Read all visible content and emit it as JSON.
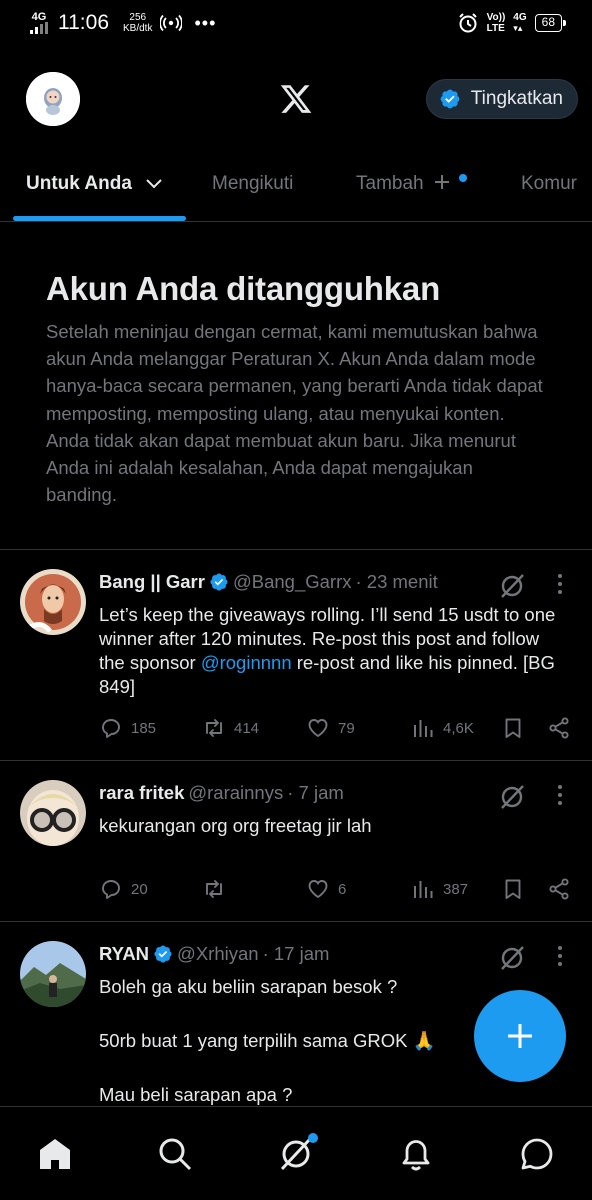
{
  "status_bar": {
    "network_left": "4G",
    "time": "11:06",
    "speed_value": "256",
    "speed_unit": "KB/dtk",
    "vo": "Vo))",
    "lte": "LTE",
    "network_right": "4G",
    "battery": "68"
  },
  "header": {
    "upgrade_label": "Tingkatkan"
  },
  "tabs": [
    {
      "label": "Untuk Anda",
      "active": true
    },
    {
      "label": "Mengikuti",
      "active": false
    },
    {
      "label": "Tambah",
      "active": false
    },
    {
      "label": "Komur",
      "active": false
    }
  ],
  "suspension": {
    "title": "Akun Anda ditangguhkan",
    "body": "Setelah meninjau dengan cermat, kami memutuskan bahwa akun Anda melanggar Peraturan X. Akun Anda dalam mode hanya-baca secara permanen, yang berarti Anda tidak dapat memposting, memposting ulang, atau menyukai konten. Anda tidak akan dapat membuat akun baru. Jika menurut Anda ini adalah kesalahan, Anda dapat mengajukan banding."
  },
  "posts": [
    {
      "name": "Bang || Garr",
      "verified": true,
      "handle": "@Bang_Garrx",
      "time": "· 23 menit",
      "text_before": "Let’s keep the giveaways rolling. I’ll send 15 usdt to one winner after 120 minutes. Re-post this post and follow the sponsor ",
      "mention": "@roginnnn",
      "text_after": " re-post and like his pinned. [BG 849]",
      "replies": "185",
      "reposts": "414",
      "likes": "79",
      "views": "4,6K"
    },
    {
      "name": "rara fritek",
      "verified": false,
      "handle": "@rarainnys",
      "time": "· 7 jam",
      "text": "kekurangan org org freetag jir lah",
      "replies": "20",
      "reposts": "",
      "likes": "6",
      "views": "387"
    },
    {
      "name": "RYAN",
      "verified": true,
      "handle": "@Xrhiyan",
      "time": "· 17 jam",
      "line1": "Boleh ga aku beliin sarapan besok ?",
      "line2": "50rb buat 1 yang terpilih sama GROK 🙏",
      "line3": "Mau beli sarapan apa ?"
    }
  ],
  "colors": {
    "accent": "#1d9bf0",
    "background": "#000000",
    "muted_text": "#71767b",
    "primary_text": "#e7e9ea",
    "divider": "#2f3336"
  },
  "icons": [
    "home-icon",
    "search-icon",
    "grok-icon",
    "bell-icon",
    "messages-icon",
    "compose-icon",
    "x-logo-icon",
    "verified-icon",
    "reply-icon",
    "repost-icon",
    "like-icon",
    "views-icon",
    "bookmark-icon",
    "share-icon",
    "more-icon"
  ]
}
